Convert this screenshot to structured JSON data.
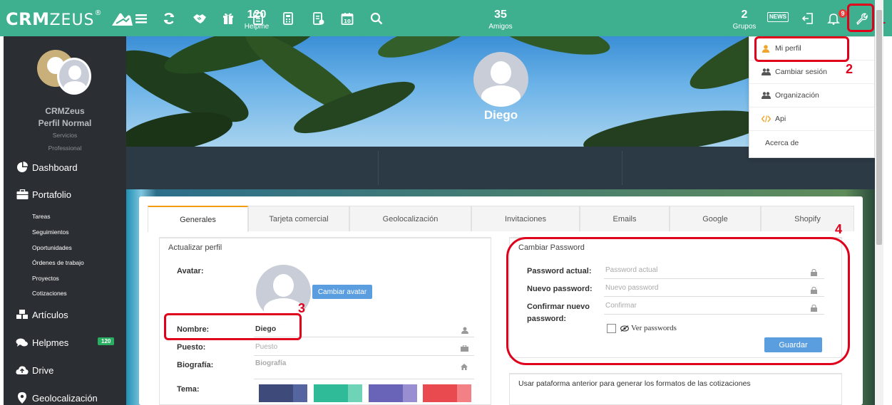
{
  "brand": {
    "logo_bold": "CRM",
    "logo_thin": "ZEUS"
  },
  "topbar": {
    "icons": [
      "menu-icon",
      "refresh-icon",
      "handshake-icon",
      "gift-icon",
      "list-icon",
      "calculator-icon",
      "receipt-icon",
      "calendar-icon",
      "search-icon"
    ],
    "calendar_day": "10",
    "news_label": "NEWS",
    "notification_count": "9"
  },
  "annotations": {
    "n1": "1",
    "n2": "2",
    "n3": "3",
    "n4": "4"
  },
  "sidebar": {
    "company": "CRMZeus",
    "profile": "Perfil Normal",
    "line1": "Servicios",
    "line2": "Professional",
    "items": [
      {
        "label": "Dashboard",
        "icon": "pie-chart-icon"
      },
      {
        "label": "Portafolio",
        "icon": "briefcase-icon"
      },
      {
        "label": "Artículos",
        "icon": "cubes-icon"
      },
      {
        "label": "Helpmes",
        "icon": "comments-icon",
        "badge": "120"
      },
      {
        "label": "Drive",
        "icon": "cloud-upload-icon"
      },
      {
        "label": "Geolocalización",
        "icon": "map-marker-icon"
      }
    ],
    "portafolio_sub": [
      "Tareas",
      "Seguimientos",
      "Oportunidades",
      "Órdenes de trabajo",
      "Proyectos",
      "Cotizaciones"
    ]
  },
  "profile": {
    "name": "Diego",
    "stats": [
      {
        "value": "120",
        "label": "Helpme"
      },
      {
        "value": "35",
        "label": "Amigos"
      },
      {
        "value": "2",
        "label": "Grupos"
      }
    ]
  },
  "tabs": [
    "Generales",
    "Tarjeta comercial",
    "Geolocalización",
    "Invitaciones",
    "Emails",
    "Google",
    "Shopify"
  ],
  "update_profile": {
    "title": "Actualizar perfil",
    "avatar_label": "Avatar:",
    "change_avatar": "Cambiar avatar",
    "name_label": "Nombre:",
    "name_value": "Diego",
    "position_label": "Puesto:",
    "position_placeholder": "Puesto",
    "bio_label": "Biografía:",
    "bio_placeholder": "Biografía",
    "theme_label": "Tema:",
    "themes": [
      {
        "a": "#3e4a7a",
        "b": "#5465a0"
      },
      {
        "a": "#2fbb97",
        "b": "#6fd3b8"
      },
      {
        "a": "#6a64b8",
        "b": "#9a8ed2"
      },
      {
        "a": "#e84a4f",
        "b": "#f28085"
      }
    ]
  },
  "change_password": {
    "title": "Cambiar Password",
    "current_label": "Password actual:",
    "current_placeholder": "Password actual",
    "new_label": "Nuevo password:",
    "new_placeholder": "Nuevo password",
    "confirm_label_1": "Confirmar nuevo",
    "confirm_label_2": "password:",
    "confirm_placeholder": "Confirmar",
    "show_label": "Ver passwords",
    "save": "Guardar"
  },
  "quote_panel": {
    "text": "Usar pataforma anterior para generar los formatos de las cotizaciones"
  },
  "dropdown": [
    {
      "label": "Mi perfil",
      "icon": "user-icon"
    },
    {
      "label": "Cambiar sesión",
      "icon": "users-icon"
    },
    {
      "label": "Organización",
      "icon": "users-icon"
    },
    {
      "label": "Api",
      "icon": "code-icon"
    },
    {
      "label": "Acerca de",
      "icon": ""
    }
  ]
}
